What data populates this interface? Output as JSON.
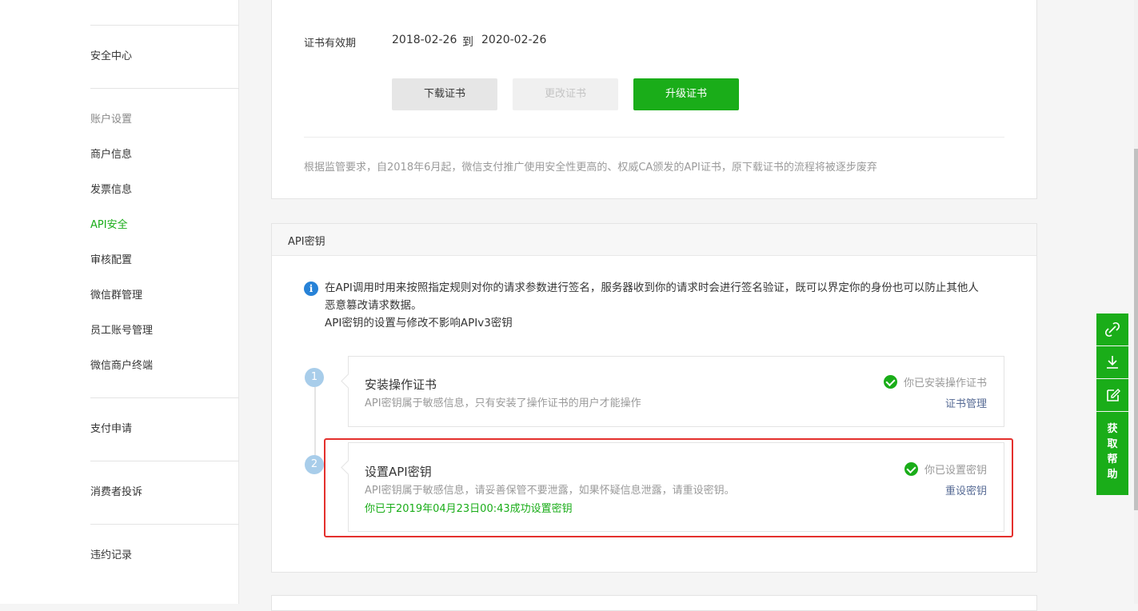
{
  "sidebar": {
    "items": [
      {
        "label": "安全中心"
      },
      {
        "label": "账户设置",
        "group": true
      },
      {
        "label": "商户信息"
      },
      {
        "label": "发票信息"
      },
      {
        "label": "API安全",
        "active": true
      },
      {
        "label": "审核配置"
      },
      {
        "label": "微信群管理"
      },
      {
        "label": "员工账号管理"
      },
      {
        "label": "微信商户终端"
      },
      {
        "label": "支付申请"
      },
      {
        "label": "消费者投诉"
      },
      {
        "label": "违约记录"
      }
    ]
  },
  "certificate": {
    "validity_label": "证书有效期",
    "start_date": "2018-02-26",
    "to": "到",
    "end_date": "2020-02-26",
    "download_button": "下载证书",
    "change_button": "更改证书",
    "upgrade_button": "升级证书",
    "notice": "根据监管要求，自2018年6月起，微信支付推广使用安全性更高的、权威CA颁发的API证书，原下载证书的流程将被逐步废弃"
  },
  "api_key": {
    "title": "API密钥",
    "info_line1": "在API调用时用来按照指定规则对你的请求参数进行签名，服务器收到你的请求时会进行签名验证，既可以界定你的身份也可以防止其他人",
    "info_line2": "恶意篡改请求数据。",
    "info_line3": "API密钥的设置与修改不影响APIv3密钥",
    "steps": [
      {
        "number": "1",
        "title": "安装操作证书",
        "desc": "API密钥属于敏感信息，只有安装了操作证书的用户才能操作",
        "status": "你已安装操作证书",
        "link": "证书管理"
      },
      {
        "number": "2",
        "title": "设置API密钥",
        "desc": "API密钥属于敏感信息，请妥善保管不要泄露，如果怀疑信息泄露，请重设密钥。",
        "success": "你已于2019年04月23日00:43成功设置密钥",
        "status": "你已设置密钥",
        "link": "重设密钥"
      }
    ]
  },
  "float_bar": {
    "icons": [
      "link-icon",
      "download-icon",
      "edit-icon"
    ],
    "help": [
      "获",
      "取",
      "帮",
      "助"
    ]
  },
  "colors": {
    "brand_green": "#1aad19",
    "link_blue": "#576b95",
    "highlight_red": "#e4302d"
  }
}
